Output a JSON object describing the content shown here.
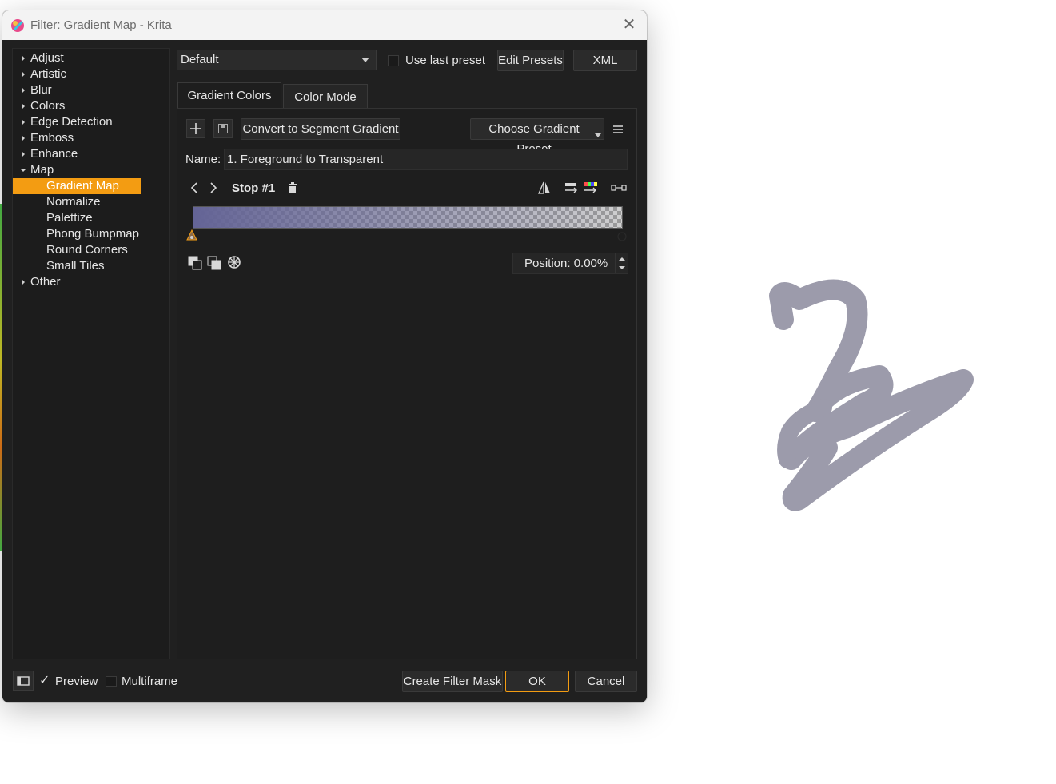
{
  "window": {
    "title": "Filter: Gradient Map - Krita"
  },
  "tree": {
    "items": [
      {
        "label": "Adjust",
        "expanded": false
      },
      {
        "label": "Artistic",
        "expanded": false
      },
      {
        "label": "Blur",
        "expanded": false
      },
      {
        "label": "Colors",
        "expanded": false
      },
      {
        "label": "Edge Detection",
        "expanded": false
      },
      {
        "label": "Emboss",
        "expanded": false
      },
      {
        "label": "Enhance",
        "expanded": false
      },
      {
        "label": "Map",
        "expanded": true
      },
      {
        "label": "Gradient Map",
        "selected": true
      },
      {
        "label": "Normalize"
      },
      {
        "label": "Palettize"
      },
      {
        "label": "Phong Bumpmap"
      },
      {
        "label": "Round Corners"
      },
      {
        "label": "Small Tiles"
      },
      {
        "label": "Other",
        "expanded": false
      }
    ]
  },
  "presets": {
    "selected": "Default",
    "use_last_label": "Use last preset",
    "edit_label": "Edit Presets",
    "xml_label": "XML"
  },
  "tabs": [
    {
      "label": "Gradient Colors",
      "active": true
    },
    {
      "label": "Color Mode",
      "active": false
    }
  ],
  "gradient": {
    "convert_label": "Convert to Segment Gradient",
    "choose_preset_label": "Choose Gradient Preset",
    "name_label": "Name:",
    "name_value": "1. Foreground to Transparent",
    "stop_label": "Stop #1",
    "position_value": "Position: 0.00%",
    "start_color": "#646496"
  },
  "footer": {
    "preview_label": "Preview",
    "multiframe_label": "Multiframe",
    "create_mask_label": "Create Filter Mask",
    "ok_label": "OK",
    "cancel_label": "Cancel"
  },
  "colors": {
    "accent": "#f39c12",
    "stroke": "#9c9bab"
  }
}
